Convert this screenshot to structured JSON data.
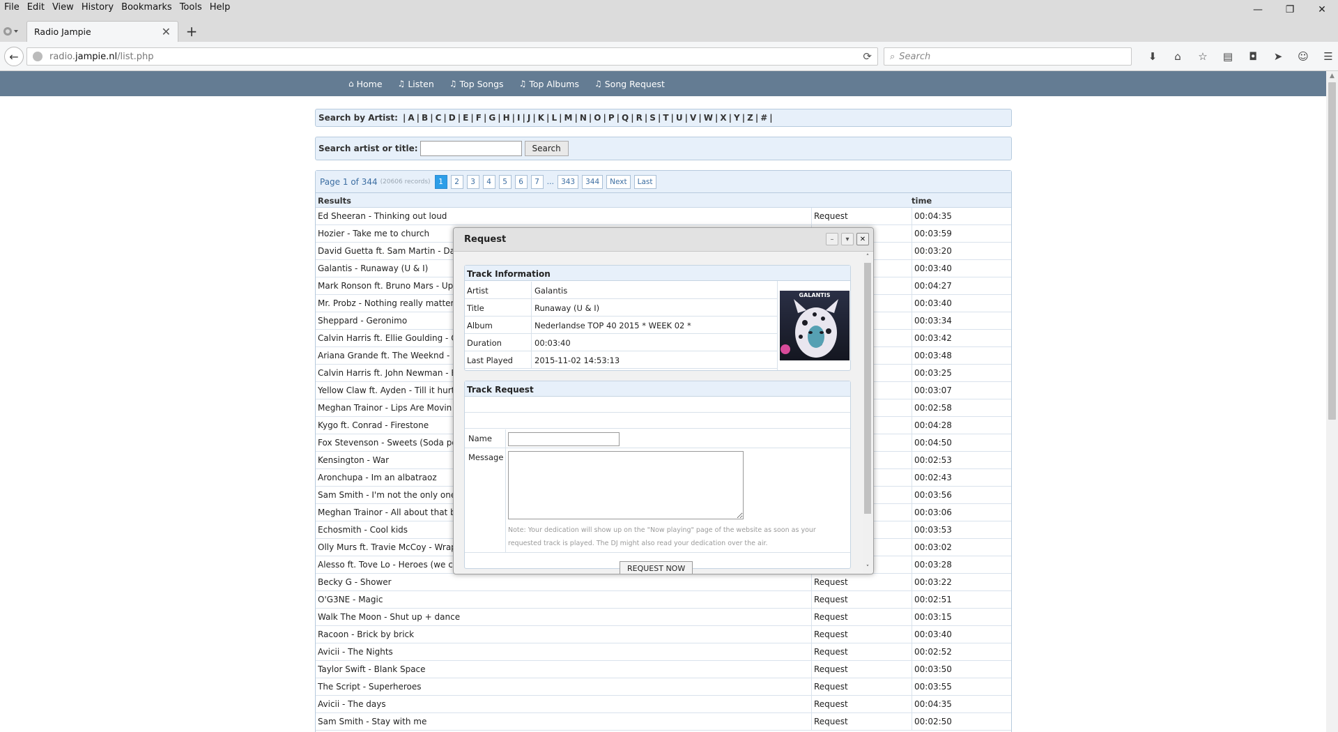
{
  "browser": {
    "menu": [
      "File",
      "Edit",
      "View",
      "History",
      "Bookmarks",
      "Tools",
      "Help"
    ],
    "window_controls": {
      "minimize": "—",
      "restore": "❐",
      "close": "✕"
    },
    "tab": {
      "title": "Radio Jampie",
      "close": "✕"
    },
    "new_tab": "+",
    "url": {
      "prefix": "radio.",
      "domain": "jampie.nl",
      "path": "/list.php"
    },
    "search_placeholder": "Search"
  },
  "site": {
    "nav": [
      {
        "glyph": "⌂",
        "label": "Home"
      },
      {
        "glyph": "♫",
        "label": "Listen"
      },
      {
        "glyph": "♫",
        "label": "Top Songs"
      },
      {
        "glyph": "♫",
        "label": "Top Albums"
      },
      {
        "glyph": "♫",
        "label": "Song Request"
      }
    ],
    "az": {
      "label": "Search by Artist:",
      "letters": [
        "A",
        "B",
        "C",
        "D",
        "E",
        "F",
        "G",
        "H",
        "I",
        "J",
        "K",
        "L",
        "M",
        "N",
        "O",
        "P",
        "Q",
        "R",
        "S",
        "T",
        "U",
        "V",
        "W",
        "X",
        "Y",
        "Z",
        "#"
      ]
    },
    "search": {
      "label": "Search artist or title:",
      "button": "Search"
    },
    "pager": {
      "info": "Page 1 of 344",
      "records": "(20606 records)",
      "pages": [
        "1",
        "2",
        "3",
        "4",
        "5",
        "6",
        "7"
      ],
      "ellipsis": "...",
      "tail_pages": [
        "343",
        "344"
      ],
      "next": "Next",
      "last": "Last"
    },
    "results": {
      "headers": {
        "title": "Results",
        "time": "time"
      },
      "request_label": "Request",
      "rows": [
        {
          "title": "Ed Sheeran - Thinking out loud",
          "time": "00:04:35"
        },
        {
          "title": "Hozier - Take me to church",
          "time": "00:03:59"
        },
        {
          "title": "David Guetta ft. Sam Martin - Dange",
          "time": "00:03:20"
        },
        {
          "title": "Galantis - Runaway (U & I)",
          "time": "00:03:40"
        },
        {
          "title": "Mark Ronson ft. Bruno Mars - Uptov",
          "time": "00:04:27"
        },
        {
          "title": "Mr. Probz - Nothing really matters",
          "time": "00:03:40"
        },
        {
          "title": "Sheppard - Geronimo",
          "time": "00:03:34"
        },
        {
          "title": "Calvin Harris ft. Ellie Goulding - Out",
          "time": "00:03:42"
        },
        {
          "title": "Ariana Grande ft. The Weeknd - Lov",
          "time": "00:03:48"
        },
        {
          "title": "Calvin Harris ft. John Newman - Bla",
          "time": "00:03:25"
        },
        {
          "title": "Yellow Claw ft. Ayden - Till it hurts",
          "time": "00:03:07"
        },
        {
          "title": "Meghan Trainor - Lips Are Movin",
          "time": "00:02:58"
        },
        {
          "title": "Kygo ft. Conrad - Firestone",
          "time": "00:04:28"
        },
        {
          "title": "Fox Stevenson - Sweets (Soda pop",
          "time": "00:04:50"
        },
        {
          "title": "Kensington - War",
          "time": "00:02:53"
        },
        {
          "title": "Aronchupa - Im an albatraoz",
          "time": "00:02:43"
        },
        {
          "title": "Sam Smith - I'm not the only one",
          "time": "00:03:56"
        },
        {
          "title": "Meghan Trainor - All about that bas",
          "time": "00:03:06"
        },
        {
          "title": "Echosmith - Cool kids",
          "time": "00:03:53"
        },
        {
          "title": "Olly Murs ft. Travie McCoy - Wrappe",
          "time": "00:03:02"
        },
        {
          "title": "Alesso ft. Tove Lo - Heroes (we cou",
          "time": "00:03:28"
        },
        {
          "title": "Becky G - Shower",
          "time": "00:03:22"
        },
        {
          "title": "O'G3NE - Magic",
          "time": "00:02:51"
        },
        {
          "title": "Walk The Moon - Shut up + dance",
          "time": "00:03:15"
        },
        {
          "title": "Racoon - Brick by brick",
          "time": "00:03:40"
        },
        {
          "title": "Avicii - The Nights",
          "time": "00:02:52"
        },
        {
          "title": "Taylor Swift - Blank Space",
          "time": "00:03:50"
        },
        {
          "title": "The Script - Superheroes",
          "time": "00:03:55"
        },
        {
          "title": "Avicii - The days",
          "time": "00:04:35"
        },
        {
          "title": "Sam Smith - Stay with me",
          "time": "00:02:50"
        }
      ]
    }
  },
  "modal": {
    "title": "Request",
    "controls": {
      "minimize": "–",
      "collapse": "▾",
      "close": "✕"
    },
    "track_info": {
      "heading": "Track Information",
      "rows": [
        {
          "key": "Artist",
          "value": "Galantis"
        },
        {
          "key": "Title",
          "value": "Runaway (U & I)"
        },
        {
          "key": "Album",
          "value": "Nederlandse TOP 40 2015 * WEEK 02 *"
        },
        {
          "key": "Duration",
          "value": "00:03:40"
        },
        {
          "key": "Last Played",
          "value": "2015-11-02 14:53:13"
        }
      ],
      "album_art_text": "GALANTIS"
    },
    "track_request": {
      "heading": "Track Request",
      "name_label": "Name",
      "message_label": "Message",
      "note": "Note: Your dedication will show up on the \"Now playing\" page of the website as soon as your requested track is played. The DJ might also read your dedication over the air.",
      "button": "REQUEST NOW"
    }
  }
}
